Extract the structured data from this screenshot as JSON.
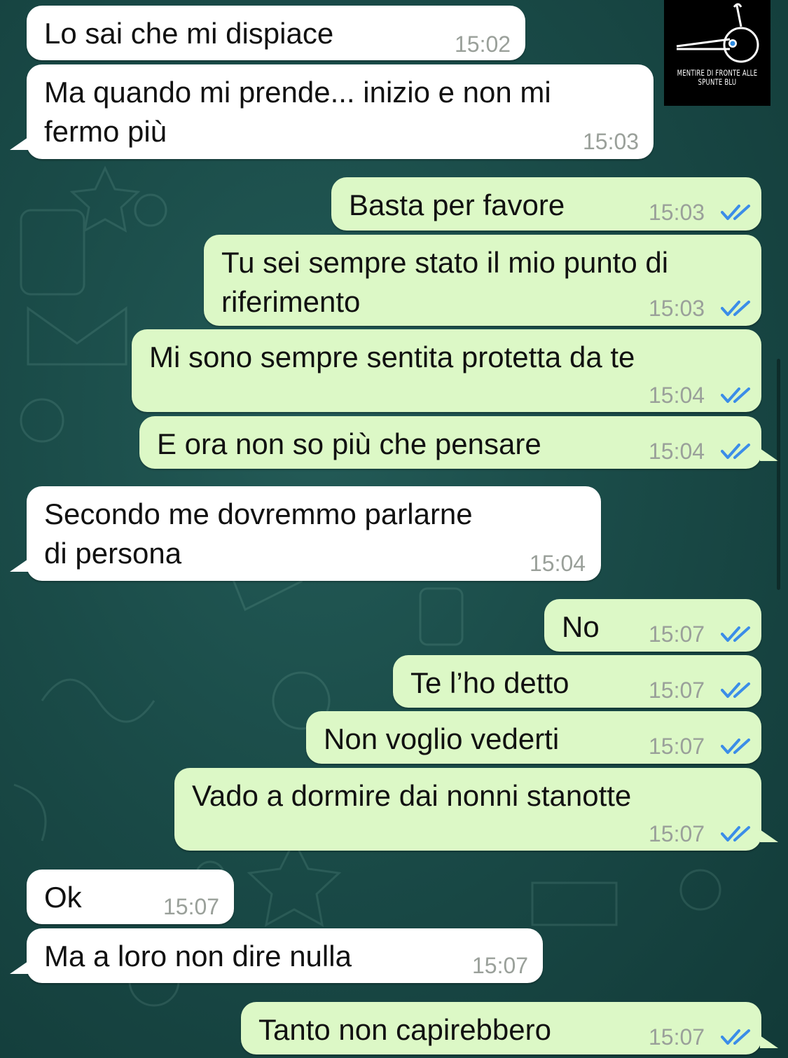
{
  "chat": {
    "messages": [
      {
        "text": "Lo sai che mi dispiace",
        "time": "15:02",
        "direction": "incoming"
      },
      {
        "text": "Ma quando mi prende... inizio e non mi\nfermo più",
        "time": "15:03",
        "direction": "incoming"
      },
      {
        "text": "Basta per favore",
        "time": "15:03",
        "direction": "outgoing",
        "status": "read"
      },
      {
        "text": "Tu sei sempre stato il mio punto di\nriferimento",
        "time": "15:03",
        "direction": "outgoing",
        "status": "read"
      },
      {
        "text": "Mi sono sempre sentita protetta da te",
        "time": "15:04",
        "direction": "outgoing",
        "status": "read"
      },
      {
        "text": "E ora non so più che pensare",
        "time": "15:04",
        "direction": "outgoing",
        "status": "read"
      },
      {
        "text": "Secondo me dovremmo parlarne\ndi persona",
        "time": "15:04",
        "direction": "incoming"
      },
      {
        "text": "No",
        "time": "15:07",
        "direction": "outgoing",
        "status": "read"
      },
      {
        "text": "Te l’ho detto",
        "time": "15:07",
        "direction": "outgoing",
        "status": "read"
      },
      {
        "text": "Non voglio vederti",
        "time": "15:07",
        "direction": "outgoing",
        "status": "read"
      },
      {
        "text": "Vado a dormire dai nonni stanotte",
        "time": "15:07",
        "direction": "outgoing",
        "status": "read"
      },
      {
        "text": "Ok",
        "time": "15:07",
        "direction": "incoming"
      },
      {
        "text": "Ma a loro non dire nulla",
        "time": "15:07",
        "direction": "incoming"
      },
      {
        "text": "Tanto non capirebbero",
        "time": "15:07",
        "direction": "outgoing",
        "status": "read"
      }
    ]
  },
  "watermark": {
    "caption": "MENTIRE DI FRONTE ALLE SPUNTE BLU",
    "icon": "pinocchio-nose-icon"
  },
  "colors": {
    "incoming_bubble": "#ffffff",
    "outgoing_bubble": "#dcf8c6",
    "read_ticks": "#3b8de8",
    "timestamp": "#9aa09a",
    "wallpaper": "#1f5350"
  }
}
